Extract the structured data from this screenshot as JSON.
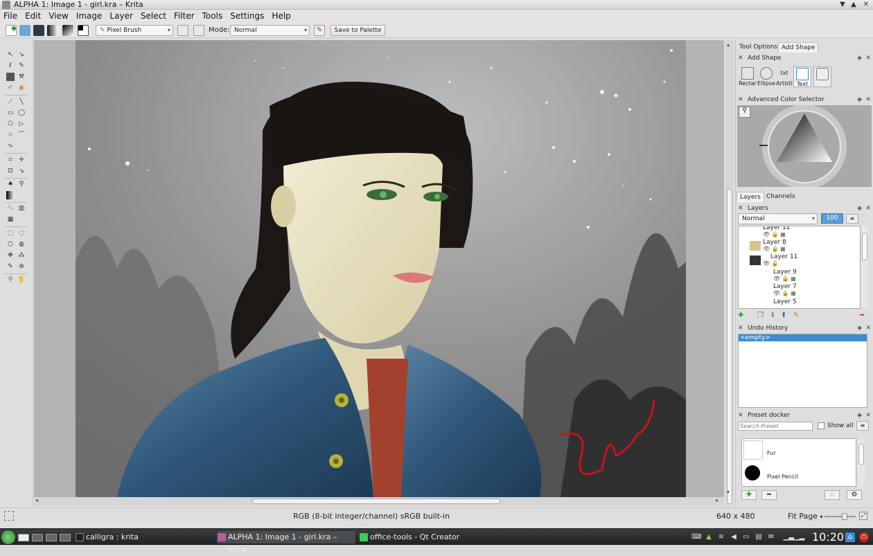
{
  "window": {
    "title": "ALPHA 1: Image 1 - girl.kra – Krita",
    "close": "✕",
    "maximize": "▲",
    "minimize": "▼"
  },
  "menu": [
    "File",
    "Edit",
    "View",
    "Image",
    "Layer",
    "Select",
    "Filter",
    "Tools",
    "Settings",
    "Help"
  ],
  "toolbar": {
    "preset": "Pixel Brush",
    "mode_label": "Mode:",
    "mode_value": "Normal",
    "save_palette": "Save to Palette"
  },
  "docks": {
    "tabs": [
      "Tool Options",
      "Add Shape"
    ],
    "active_tab": "Add Shape",
    "add_shape": {
      "title": "Add Shape",
      "shapes": [
        "Rectar",
        "Ellipse",
        "Artisti",
        "Text"
      ]
    },
    "color_selector": {
      "title": "Advanced Color Selector"
    },
    "layers_tabs": [
      "Layers",
      "Channels"
    ],
    "layers": {
      "title": "Layers",
      "blend": "Normal",
      "opacity": "100",
      "items": [
        {
          "name": "Layer 11"
        },
        {
          "name": "Layer 8"
        },
        {
          "name": "Layer 11"
        },
        {
          "name": "Layer 9"
        },
        {
          "name": "Layer 7"
        },
        {
          "name": "Layer 5"
        }
      ]
    },
    "undo": {
      "title": "Undo History",
      "items": [
        "<empty>"
      ]
    },
    "presets": {
      "title": "Preset docker",
      "search_placeholder": "Search Preset",
      "show_all": "Show all",
      "items": [
        "Fur",
        "Pixel Pencil"
      ]
    }
  },
  "status": {
    "colorspace": "RGB (8-bit integer/channel)  sRGB built-in",
    "size": "640 x 480",
    "zoom": "Fit Page"
  },
  "taskbar": {
    "tasks": [
      "calligra : krita",
      "ALPHA 1: Image 1 - girl.kra – Krita",
      "office-tools - Qt Creator"
    ],
    "clock": "10:20"
  },
  "colors": {
    "accent": "#3c8ad6",
    "signature": "#c8131a",
    "taskbar": "#2a2c2e"
  }
}
